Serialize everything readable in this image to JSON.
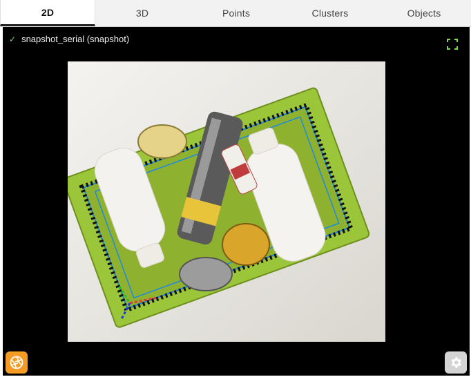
{
  "tabs": [
    {
      "label": "2D",
      "active": true
    },
    {
      "label": "3D",
      "active": false
    },
    {
      "label": "Points",
      "active": false
    },
    {
      "label": "Clusters",
      "active": false
    },
    {
      "label": "Objects",
      "active": false
    }
  ],
  "status": {
    "icon": "check-icon",
    "text": "snapshot_serial (snapshot)"
  },
  "icons": {
    "fullscreen": "fullscreen-icon",
    "capture": "camera-aperture-icon",
    "settings": "gear-icon"
  },
  "colors": {
    "check": "#7ed957",
    "fullscreen": "#7ed957",
    "capture_button": "#f39b24",
    "settings_button": "#d4d4d4",
    "box_outline": "#1e88e5",
    "crate": "#9cc63a"
  }
}
